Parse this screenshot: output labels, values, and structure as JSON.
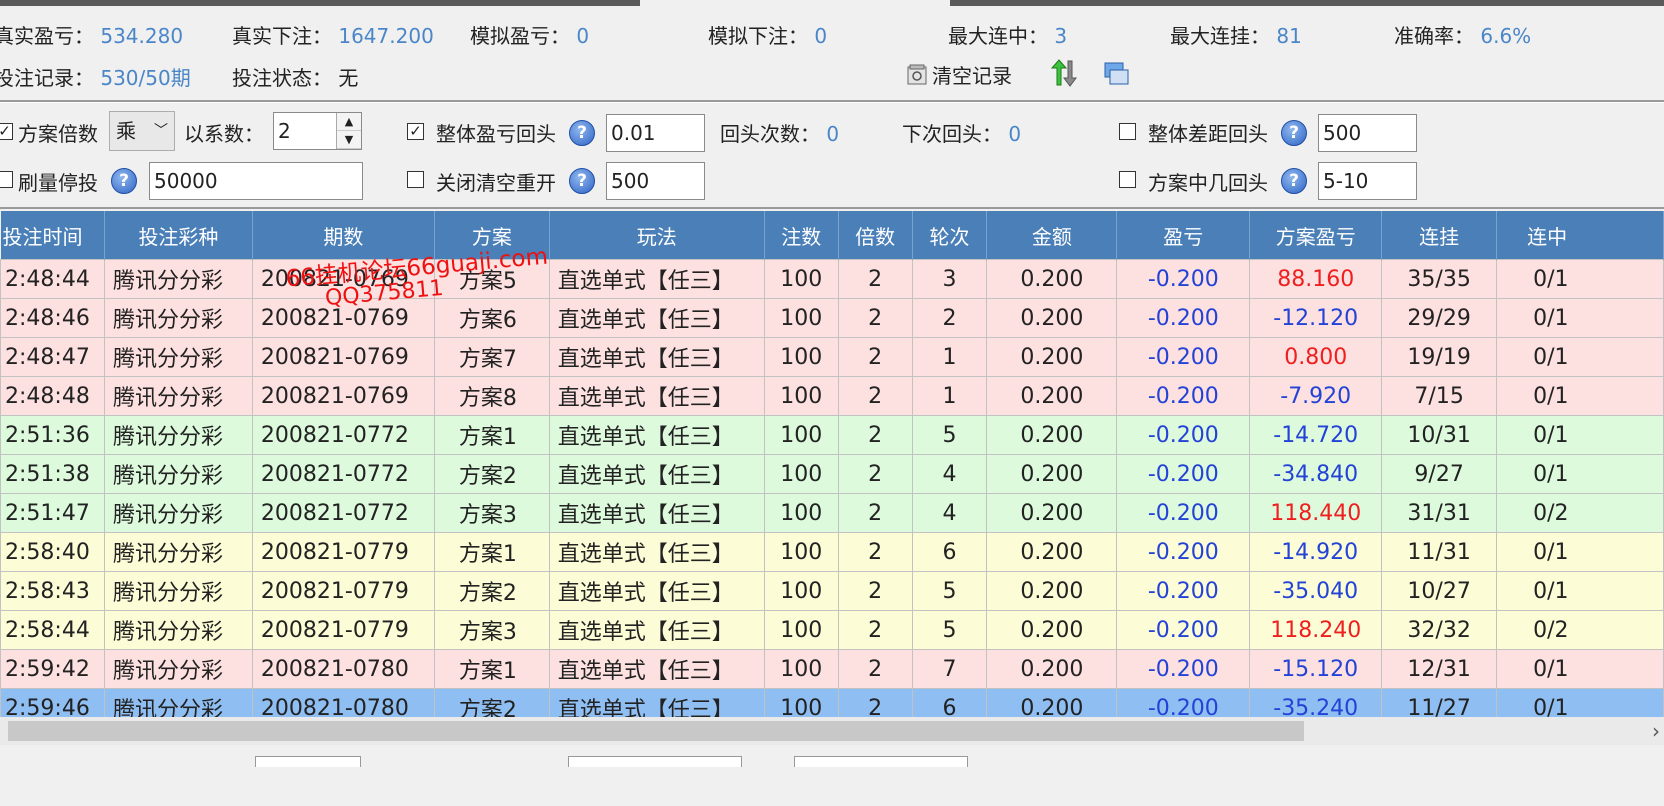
{
  "stats": {
    "row1": [
      {
        "label": "真实盈亏：",
        "value": "534.280"
      },
      {
        "label": "真实下注：",
        "value": "1647.200"
      },
      {
        "label": "模拟盈亏：",
        "value": "0"
      },
      {
        "label": "模拟下注：",
        "value": "0"
      },
      {
        "label": "最大连中：",
        "value": "3"
      },
      {
        "label": "最大连挂：",
        "value": "81"
      },
      {
        "label": "准确率：",
        "value": "6.6%"
      }
    ],
    "row2": [
      {
        "label": "投注记录：",
        "value": "530/50期"
      },
      {
        "label": "投注状态：",
        "value": "无"
      }
    ],
    "clear_label": "清空记录"
  },
  "options": {
    "plan_multiplier": {
      "label": "方案倍数",
      "checked": true,
      "mode": "乘",
      "coef_label": "以系数：",
      "coef_value": "2"
    },
    "overall_pl_return": {
      "label": "整体盈亏回头",
      "checked": true,
      "value": "0.01"
    },
    "return_count": {
      "label": "回头次数：",
      "value": "0"
    },
    "next_return": {
      "label": "下次回头：",
      "value": "0"
    },
    "overall_gap_return": {
      "label": "整体差距回头",
      "checked": false,
      "value": "500"
    },
    "volume_stop": {
      "label": "刷量停投",
      "checked": false,
      "value": "50000"
    },
    "close_clear_restart": {
      "label": "关闭清空重开",
      "checked": false,
      "value": "500"
    },
    "plan_hit_return": {
      "label": "方案中几回头",
      "checked": false,
      "value": "5-10"
    }
  },
  "table": {
    "headers": [
      "投注时间",
      "投注彩种",
      "期数",
      "方案",
      "玩法",
      "注数",
      "倍数",
      "轮次",
      "金额",
      "盈亏",
      "方案盈亏",
      "连挂",
      "连中"
    ],
    "rows": [
      {
        "time": "2:48:44",
        "lottery": "腾讯分分彩",
        "period": "200821-0769",
        "plan": "方案5",
        "play": "直选单式【任三】",
        "count": "100",
        "mult": "2",
        "round": "3",
        "amount": "0.200",
        "pl": "-0.200",
        "plan_pl": "88.160",
        "plan_pl_color": "red",
        "lose": "35/35",
        "win": "0/1",
        "color": "pink"
      },
      {
        "time": "2:48:46",
        "lottery": "腾讯分分彩",
        "period": "200821-0769",
        "plan": "方案6",
        "play": "直选单式【任三】",
        "count": "100",
        "mult": "2",
        "round": "2",
        "amount": "0.200",
        "pl": "-0.200",
        "plan_pl": "-12.120",
        "plan_pl_color": "blue",
        "lose": "29/29",
        "win": "0/1",
        "color": "pink"
      },
      {
        "time": "2:48:47",
        "lottery": "腾讯分分彩",
        "period": "200821-0769",
        "plan": "方案7",
        "play": "直选单式【任三】",
        "count": "100",
        "mult": "2",
        "round": "1",
        "amount": "0.200",
        "pl": "-0.200",
        "plan_pl": "0.800",
        "plan_pl_color": "red",
        "lose": "19/19",
        "win": "0/1",
        "color": "pink"
      },
      {
        "time": "2:48:48",
        "lottery": "腾讯分分彩",
        "period": "200821-0769",
        "plan": "方案8",
        "play": "直选单式【任三】",
        "count": "100",
        "mult": "2",
        "round": "1",
        "amount": "0.200",
        "pl": "-0.200",
        "plan_pl": "-7.920",
        "plan_pl_color": "blue",
        "lose": "7/15",
        "win": "0/1",
        "color": "pink"
      },
      {
        "time": "2:51:36",
        "lottery": "腾讯分分彩",
        "period": "200821-0772",
        "plan": "方案1",
        "play": "直选单式【任三】",
        "count": "100",
        "mult": "2",
        "round": "5",
        "amount": "0.200",
        "pl": "-0.200",
        "plan_pl": "-14.720",
        "plan_pl_color": "blue",
        "lose": "10/31",
        "win": "0/1",
        "color": "green"
      },
      {
        "time": "2:51:38",
        "lottery": "腾讯分分彩",
        "period": "200821-0772",
        "plan": "方案2",
        "play": "直选单式【任三】",
        "count": "100",
        "mult": "2",
        "round": "4",
        "amount": "0.200",
        "pl": "-0.200",
        "plan_pl": "-34.840",
        "plan_pl_color": "blue",
        "lose": "9/27",
        "win": "0/1",
        "color": "green"
      },
      {
        "time": "2:51:47",
        "lottery": "腾讯分分彩",
        "period": "200821-0772",
        "plan": "方案3",
        "play": "直选单式【任三】",
        "count": "100",
        "mult": "2",
        "round": "4",
        "amount": "0.200",
        "pl": "-0.200",
        "plan_pl": "118.440",
        "plan_pl_color": "red",
        "lose": "31/31",
        "win": "0/2",
        "color": "green"
      },
      {
        "time": "2:58:40",
        "lottery": "腾讯分分彩",
        "period": "200821-0779",
        "plan": "方案1",
        "play": "直选单式【任三】",
        "count": "100",
        "mult": "2",
        "round": "6",
        "amount": "0.200",
        "pl": "-0.200",
        "plan_pl": "-14.920",
        "plan_pl_color": "blue",
        "lose": "11/31",
        "win": "0/1",
        "color": "yellow"
      },
      {
        "time": "2:58:43",
        "lottery": "腾讯分分彩",
        "period": "200821-0779",
        "plan": "方案2",
        "play": "直选单式【任三】",
        "count": "100",
        "mult": "2",
        "round": "5",
        "amount": "0.200",
        "pl": "-0.200",
        "plan_pl": "-35.040",
        "plan_pl_color": "blue",
        "lose": "10/27",
        "win": "0/1",
        "color": "yellow"
      },
      {
        "time": "2:58:44",
        "lottery": "腾讯分分彩",
        "period": "200821-0779",
        "plan": "方案3",
        "play": "直选单式【任三】",
        "count": "100",
        "mult": "2",
        "round": "5",
        "amount": "0.200",
        "pl": "-0.200",
        "plan_pl": "118.240",
        "plan_pl_color": "red",
        "lose": "32/32",
        "win": "0/2",
        "color": "yellow"
      },
      {
        "time": "2:59:42",
        "lottery": "腾讯分分彩",
        "period": "200821-0780",
        "plan": "方案1",
        "play": "直选单式【任三】",
        "count": "100",
        "mult": "2",
        "round": "7",
        "amount": "0.200",
        "pl": "-0.200",
        "plan_pl": "-15.120",
        "plan_pl_color": "blue",
        "lose": "12/31",
        "win": "0/1",
        "color": "pink"
      },
      {
        "time": "2:59:46",
        "lottery": "腾讯分分彩",
        "period": "200821-0780",
        "plan": "方案2",
        "play": "直选单式【任三】",
        "count": "100",
        "mult": "2",
        "round": "6",
        "amount": "0.200",
        "pl": "-0.200",
        "plan_pl": "-35.240",
        "plan_pl_color": "blue",
        "lose": "11/27",
        "win": "0/1",
        "color": "blue"
      }
    ]
  },
  "watermark": {
    "line1": "66挂机论坛66guaji.com",
    "line2": "QQ375811"
  },
  "icons": {
    "clear": "clear-records-icon",
    "sort": "sort-arrows-icon",
    "window": "window-icon"
  }
}
